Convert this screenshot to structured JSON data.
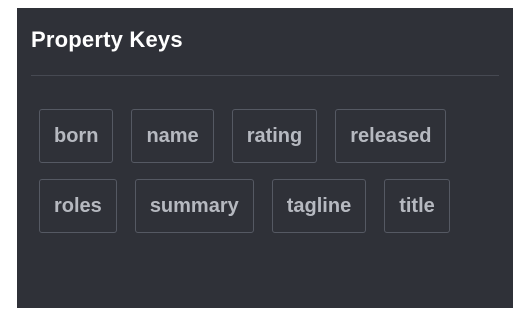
{
  "panel": {
    "title": "Property Keys"
  },
  "property_keys": [
    {
      "label": "born"
    },
    {
      "label": "name"
    },
    {
      "label": "rating"
    },
    {
      "label": "released"
    },
    {
      "label": "roles"
    },
    {
      "label": "summary"
    },
    {
      "label": "tagline"
    },
    {
      "label": "title"
    }
  ],
  "colors": {
    "panel_background": "#2f3138",
    "title_text": "#ffffff",
    "tag_text": "#b6b9c0",
    "tag_border": "#555963"
  }
}
